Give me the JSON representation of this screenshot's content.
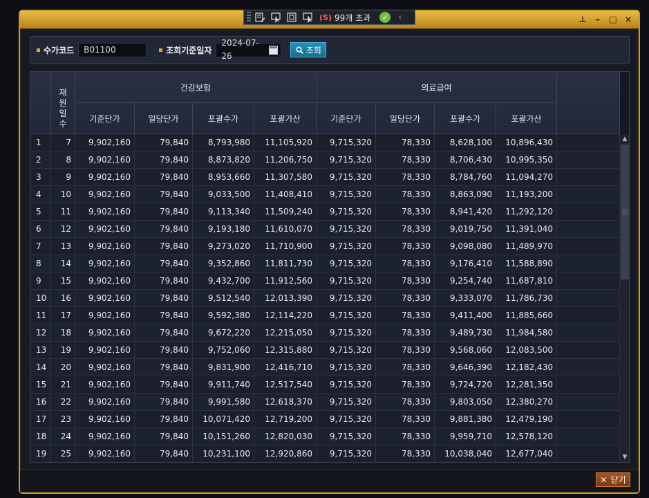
{
  "toolbar": {
    "badge": "(S)",
    "status_text": "99개 초과",
    "check_glyph": "✓",
    "chevron": "‹",
    "icons": [
      "edit-list-icon",
      "pointer-icon",
      "square-icon",
      "screen-pointer-icon"
    ]
  },
  "window": {
    "buttons": [
      "pin-icon",
      "minimize-icon",
      "maximize-icon",
      "close-icon"
    ]
  },
  "filter": {
    "code_label": "수가코드",
    "code_value": "B01100",
    "date_label": "조회기준일자",
    "date_value": "2024-07-26",
    "search_label": "조회"
  },
  "table": {
    "group_headers": [
      "건강보험",
      "의료급여"
    ],
    "rowhead": "재원일수",
    "sub_headers": [
      "기준단가",
      "일당단가",
      "포괄수가",
      "포괄가산",
      "기준단가",
      "일당단가",
      "포괄수가",
      "포괄가산"
    ],
    "rows": [
      [
        "1",
        "7",
        "9,902,160",
        "79,840",
        "8,793,980",
        "11,105,920",
        "9,715,320",
        "78,330",
        "8,628,100",
        "10,896,430"
      ],
      [
        "2",
        "8",
        "9,902,160",
        "79,840",
        "8,873,820",
        "11,206,750",
        "9,715,320",
        "78,330",
        "8,706,430",
        "10,995,350"
      ],
      [
        "3",
        "9",
        "9,902,160",
        "79,840",
        "8,953,660",
        "11,307,580",
        "9,715,320",
        "78,330",
        "8,784,760",
        "11,094,270"
      ],
      [
        "4",
        "10",
        "9,902,160",
        "79,840",
        "9,033,500",
        "11,408,410",
        "9,715,320",
        "78,330",
        "8,863,090",
        "11,193,200"
      ],
      [
        "5",
        "11",
        "9,902,160",
        "79,840",
        "9,113,340",
        "11,509,240",
        "9,715,320",
        "78,330",
        "8,941,420",
        "11,292,120"
      ],
      [
        "6",
        "12",
        "9,902,160",
        "79,840",
        "9,193,180",
        "11,610,070",
        "9,715,320",
        "78,330",
        "9,019,750",
        "11,391,040"
      ],
      [
        "7",
        "13",
        "9,902,160",
        "79,840",
        "9,273,020",
        "11,710,900",
        "9,715,320",
        "78,330",
        "9,098,080",
        "11,489,970"
      ],
      [
        "8",
        "14",
        "9,902,160",
        "79,840",
        "9,352,860",
        "11,811,730",
        "9,715,320",
        "78,330",
        "9,176,410",
        "11,588,890"
      ],
      [
        "9",
        "15",
        "9,902,160",
        "79,840",
        "9,432,700",
        "11,912,560",
        "9,715,320",
        "78,330",
        "9,254,740",
        "11,687,810"
      ],
      [
        "10",
        "16",
        "9,902,160",
        "79,840",
        "9,512,540",
        "12,013,390",
        "9,715,320",
        "78,330",
        "9,333,070",
        "11,786,730"
      ],
      [
        "11",
        "17",
        "9,902,160",
        "79,840",
        "9,592,380",
        "12,114,220",
        "9,715,320",
        "78,330",
        "9,411,400",
        "11,885,660"
      ],
      [
        "12",
        "18",
        "9,902,160",
        "79,840",
        "9,672,220",
        "12,215,050",
        "9,715,320",
        "78,330",
        "9,489,730",
        "11,984,580"
      ],
      [
        "13",
        "19",
        "9,902,160",
        "79,840",
        "9,752,060",
        "12,315,880",
        "9,715,320",
        "78,330",
        "9,568,060",
        "12,083,500"
      ],
      [
        "14",
        "20",
        "9,902,160",
        "79,840",
        "9,831,900",
        "12,416,710",
        "9,715,320",
        "78,330",
        "9,646,390",
        "12,182,430"
      ],
      [
        "15",
        "21",
        "9,902,160",
        "79,840",
        "9,911,740",
        "12,517,540",
        "9,715,320",
        "78,330",
        "9,724,720",
        "12,281,350"
      ],
      [
        "16",
        "22",
        "9,902,160",
        "79,840",
        "9,991,580",
        "12,618,370",
        "9,715,320",
        "78,330",
        "9,803,050",
        "12,380,270"
      ],
      [
        "17",
        "23",
        "9,902,160",
        "79,840",
        "10,071,420",
        "12,719,200",
        "9,715,320",
        "78,330",
        "9,881,380",
        "12,479,190"
      ],
      [
        "18",
        "24",
        "9,902,160",
        "79,840",
        "10,151,260",
        "12,820,030",
        "9,715,320",
        "78,330",
        "9,959,710",
        "12,578,120"
      ],
      [
        "19",
        "25",
        "9,902,160",
        "79,840",
        "10,231,100",
        "12,920,860",
        "9,715,320",
        "78,330",
        "10,038,040",
        "12,677,040"
      ]
    ]
  },
  "footer": {
    "close_label": "닫기",
    "close_glyph": "✕"
  },
  "colors": {
    "frame_accent": "#c89a2e",
    "search_button": "#1f7fa8",
    "close_button": "#8f4617"
  }
}
